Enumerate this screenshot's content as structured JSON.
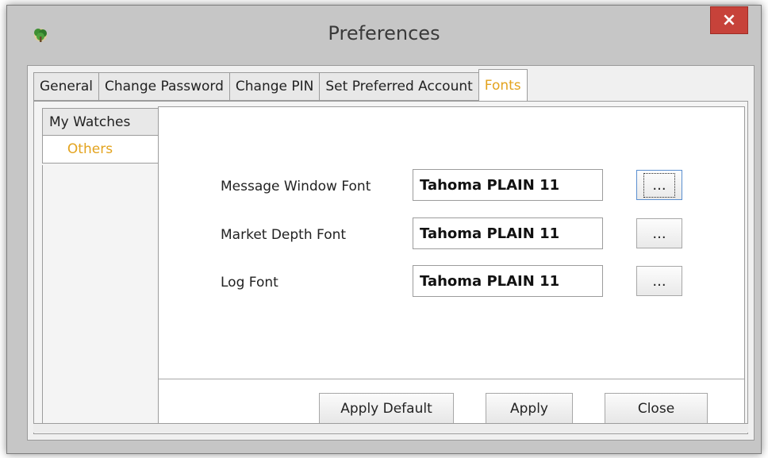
{
  "window": {
    "title": "Preferences",
    "close_label": "×"
  },
  "tabs": [
    {
      "label": "General"
    },
    {
      "label": "Change Password"
    },
    {
      "label": "Change PIN"
    },
    {
      "label": "Set Preferred Account"
    },
    {
      "label": "Fonts",
      "active": true
    }
  ],
  "side_tabs": [
    {
      "label": "My Watches"
    },
    {
      "label": "Others",
      "active": true
    }
  ],
  "font_settings": [
    {
      "label": "Message Window Font",
      "value": "Tahoma PLAIN 11",
      "button": "..."
    },
    {
      "label": "Market Depth Font",
      "value": "Tahoma PLAIN 11",
      "button": "..."
    },
    {
      "label": "Log Font",
      "value": "Tahoma PLAIN 11",
      "button": "..."
    }
  ],
  "buttons": {
    "apply_default": "Apply Default",
    "apply": "Apply",
    "close": "Close"
  },
  "colors": {
    "active_tab_text": "#e3a31e",
    "close_button": "#c7423a"
  },
  "icons": {
    "app": "tree-icon"
  }
}
